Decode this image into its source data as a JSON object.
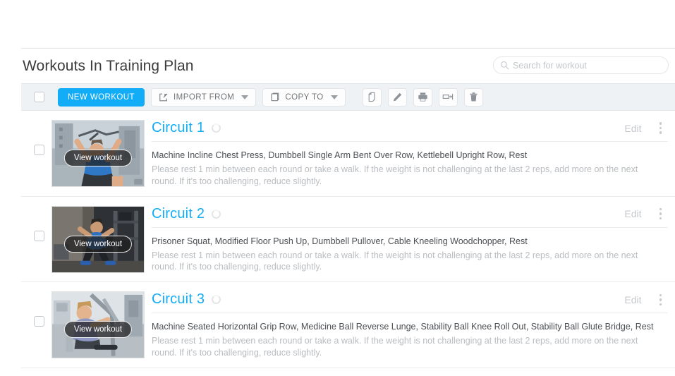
{
  "header": {
    "title": "Workouts In Training Plan"
  },
  "search": {
    "placeholder": "Search for workout",
    "value": "",
    "icon": "search-icon"
  },
  "toolbar": {
    "select_all_checkbox": "",
    "new_workout_label": "NEW WORKOUT",
    "import_from_label": "IMPORT FROM",
    "copy_to_label": "COPY TO",
    "icons": [
      {
        "name": "duplicate-icon",
        "title": "Duplicate"
      },
      {
        "name": "edit-pencil-icon",
        "title": "Edit"
      },
      {
        "name": "print-icon",
        "title": "Print"
      },
      {
        "name": "export-icon",
        "title": "Export"
      },
      {
        "name": "trash-icon",
        "title": "Delete"
      }
    ]
  },
  "colors": {
    "accent": "#13acf6",
    "toolbar_bg": "#eef2f5",
    "border": "#e1e5e9",
    "muted_text": "#b9bdc1",
    "body_text": "#4b4f53"
  },
  "common": {
    "view_workout_label": "View workout",
    "edit_label": "Edit",
    "note": "Please rest 1 min between each round or take a walk. If the weight is not challenging at the last 2 reps, add more on the next round. If it's too challenging, reduce slightly."
  },
  "workouts": [
    {
      "title": "Circuit 1",
      "exercises": "Machine Incline Chest Press, Dumbbell Single Arm Bent Over Row, Kettlebell Upright Row, Rest",
      "note": "Please rest 1 min between each round or take a walk. If the weight is not challenging at the last 2 reps, add more on the next round. If it's too challenging, reduce slightly.",
      "edit_label": "Edit",
      "view_label": "View workout",
      "thumb_alt": "man performing machine incline chest press in gym"
    },
    {
      "title": "Circuit 2",
      "exercises": "Prisoner Squat, Modified Floor Push Up, Dumbbell Pullover, Cable Kneeling Woodchopper, Rest",
      "note": "Please rest 1 min between each round or take a walk. If the weight is not challenging at the last 2 reps, add more on the next round. If it's too challenging, reduce slightly.",
      "edit_label": "Edit",
      "view_label": "View workout",
      "thumb_alt": "man in blue shirt doing cable woodchopper in dark gym"
    },
    {
      "title": "Circuit 3",
      "exercises": "Machine Seated Horizontal Grip Row, Medicine Ball Reverse Lunge, Stability Ball Knee Roll Out, Stability Ball Glute Bridge, Rest",
      "note": "Please rest 1 min between each round or take a walk. If the weight is not challenging at the last 2 reps, add more on the next round. If it's too challenging, reduce slightly.",
      "edit_label": "Edit",
      "view_label": "View workout",
      "thumb_alt": "man on seated row machine in bright gym"
    }
  ]
}
